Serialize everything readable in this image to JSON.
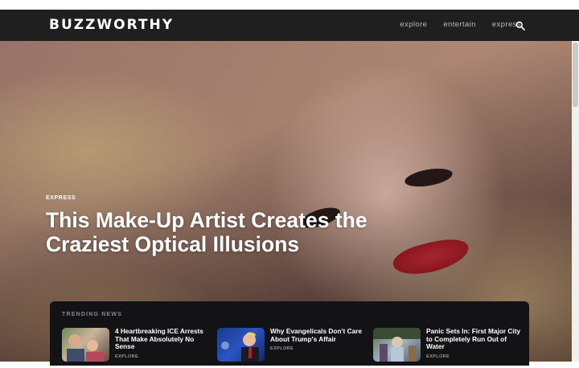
{
  "header": {
    "logo": "BUZZWORTHY",
    "nav": [
      "explore",
      "entertain",
      "express"
    ],
    "search_icon": "search-icon"
  },
  "hero": {
    "category": "EXPRESS",
    "headline": "This Make-Up Artist Creates the Craziest Optical Illusions"
  },
  "trending": {
    "title": "TRENDING NEWS",
    "items": [
      {
        "title": "4 Heartbreaking ICE Arrests That Make Absolutely No Sense",
        "tag": "EXPLORE"
      },
      {
        "title": "Why Evangelicals Don't Care About Trump's Affair",
        "tag": "EXPLORE"
      },
      {
        "title": "Panic Sets In: First Major City to Completely Run Out of Water",
        "tag": "EXPLORE"
      }
    ]
  },
  "colors": {
    "navbar": "#1f1f1f",
    "trending_bg": "#131214",
    "accent_text": "#ffffff"
  }
}
